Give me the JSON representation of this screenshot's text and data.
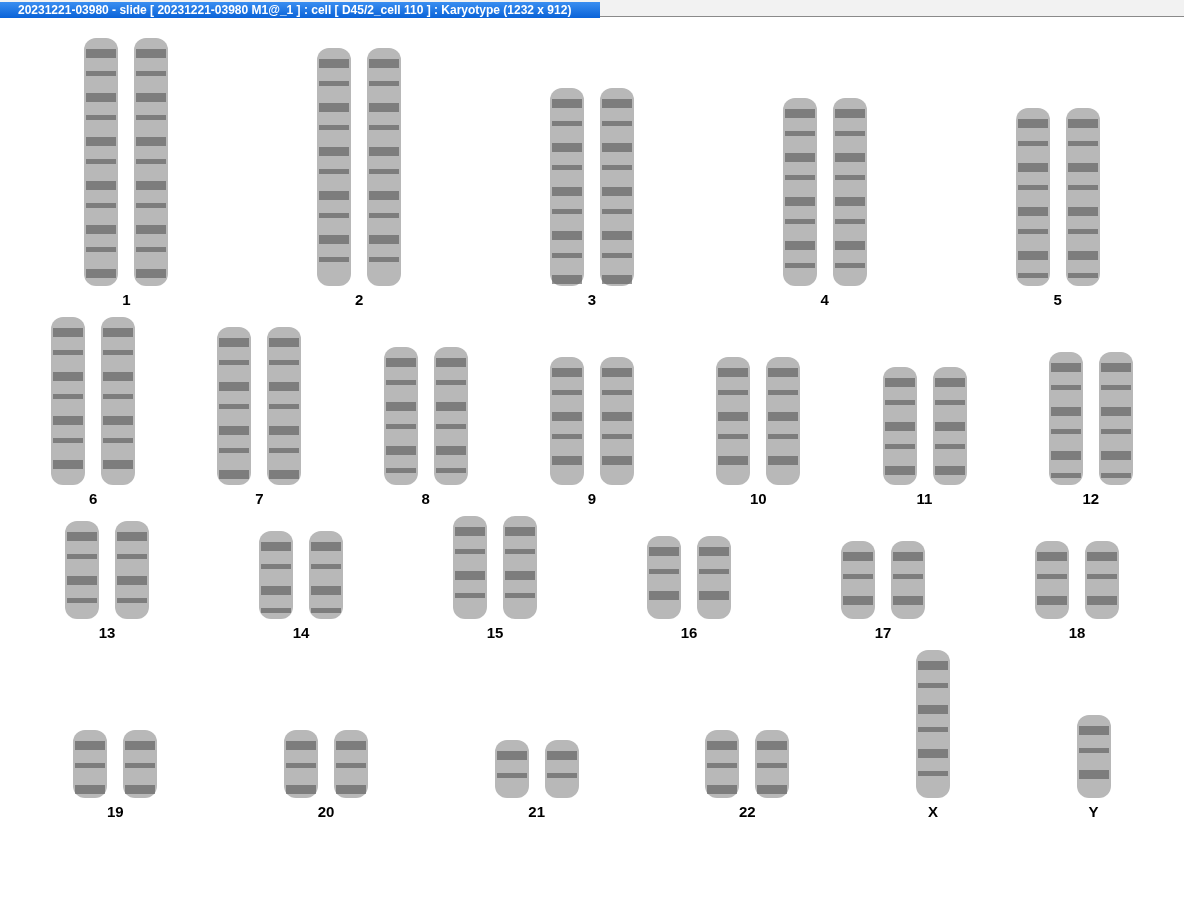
{
  "window": {
    "title": "20231221-03980 - slide [ 20231221-03980 M1@_1 ] : cell [ D45/2_cell 110 ] : Karyotype  (1232 x 912)"
  },
  "karyotype": {
    "rows": [
      {
        "chromosomes": [
          {
            "label": "1",
            "kind": "pair"
          },
          {
            "label": "2",
            "kind": "pair"
          },
          {
            "label": "3",
            "kind": "pair"
          },
          {
            "label": "4",
            "kind": "pair"
          },
          {
            "label": "5",
            "kind": "pair"
          }
        ]
      },
      {
        "chromosomes": [
          {
            "label": "6",
            "kind": "pair"
          },
          {
            "label": "7",
            "kind": "pair"
          },
          {
            "label": "8",
            "kind": "pair"
          },
          {
            "label": "9",
            "kind": "pair"
          },
          {
            "label": "10",
            "kind": "pair"
          },
          {
            "label": "11",
            "kind": "pair"
          },
          {
            "label": "12",
            "kind": "pair"
          }
        ]
      },
      {
        "chromosomes": [
          {
            "label": "13",
            "kind": "pair"
          },
          {
            "label": "14",
            "kind": "pair"
          },
          {
            "label": "15",
            "kind": "pair"
          },
          {
            "label": "16",
            "kind": "pair"
          },
          {
            "label": "17",
            "kind": "pair"
          },
          {
            "label": "18",
            "kind": "pair"
          }
        ]
      },
      {
        "chromosomes": [
          {
            "label": "19",
            "kind": "pair"
          },
          {
            "label": "20",
            "kind": "pair"
          },
          {
            "label": "21",
            "kind": "pair"
          },
          {
            "label": "22",
            "kind": "pair"
          },
          {
            "label": "X",
            "kind": "single"
          },
          {
            "label": "Y",
            "kind": "single"
          }
        ]
      }
    ]
  }
}
